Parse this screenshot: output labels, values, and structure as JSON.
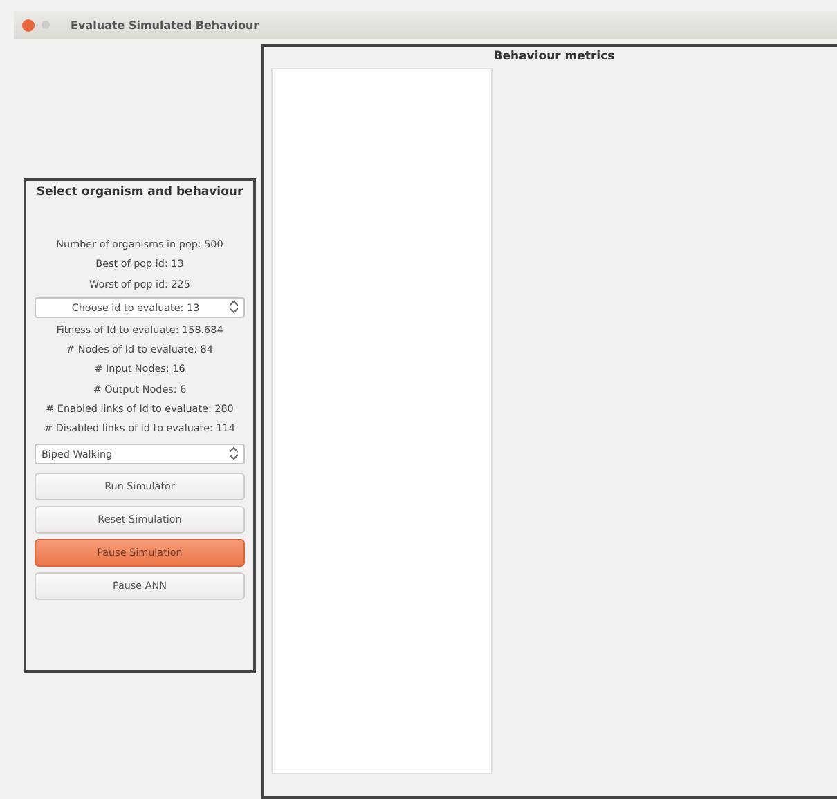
{
  "window": {
    "title": "Evaluate Simulated Behaviour"
  },
  "selection_panel": {
    "title": "Select organism and behaviour",
    "info_top": [
      "Number of organisms in pop: 500",
      "Best of pop id: 13",
      "Worst of pop id: 225"
    ],
    "id_spinner": {
      "value": "Choose id to evaluate: 13"
    },
    "info_bottom": [
      "Fitness of Id to evaluate: 158.684",
      "# Nodes of Id to evaluate: 84",
      "# Input Nodes: 16",
      "# Output Nodes: 6",
      "# Enabled links of Id to evaluate: 280",
      "# Disabled links of Id to evaluate: 114"
    ],
    "behaviour_select": {
      "value": "Biped Walking"
    },
    "buttons": [
      {
        "label": "Run Simulator",
        "highlighted": false
      },
      {
        "label": "Reset Simulation",
        "highlighted": false
      },
      {
        "label": "Pause Simulation",
        "highlighted": true
      },
      {
        "label": "Pause ANN",
        "highlighted": false
      }
    ]
  },
  "metrics_panel": {
    "title": "Behaviour metrics"
  }
}
